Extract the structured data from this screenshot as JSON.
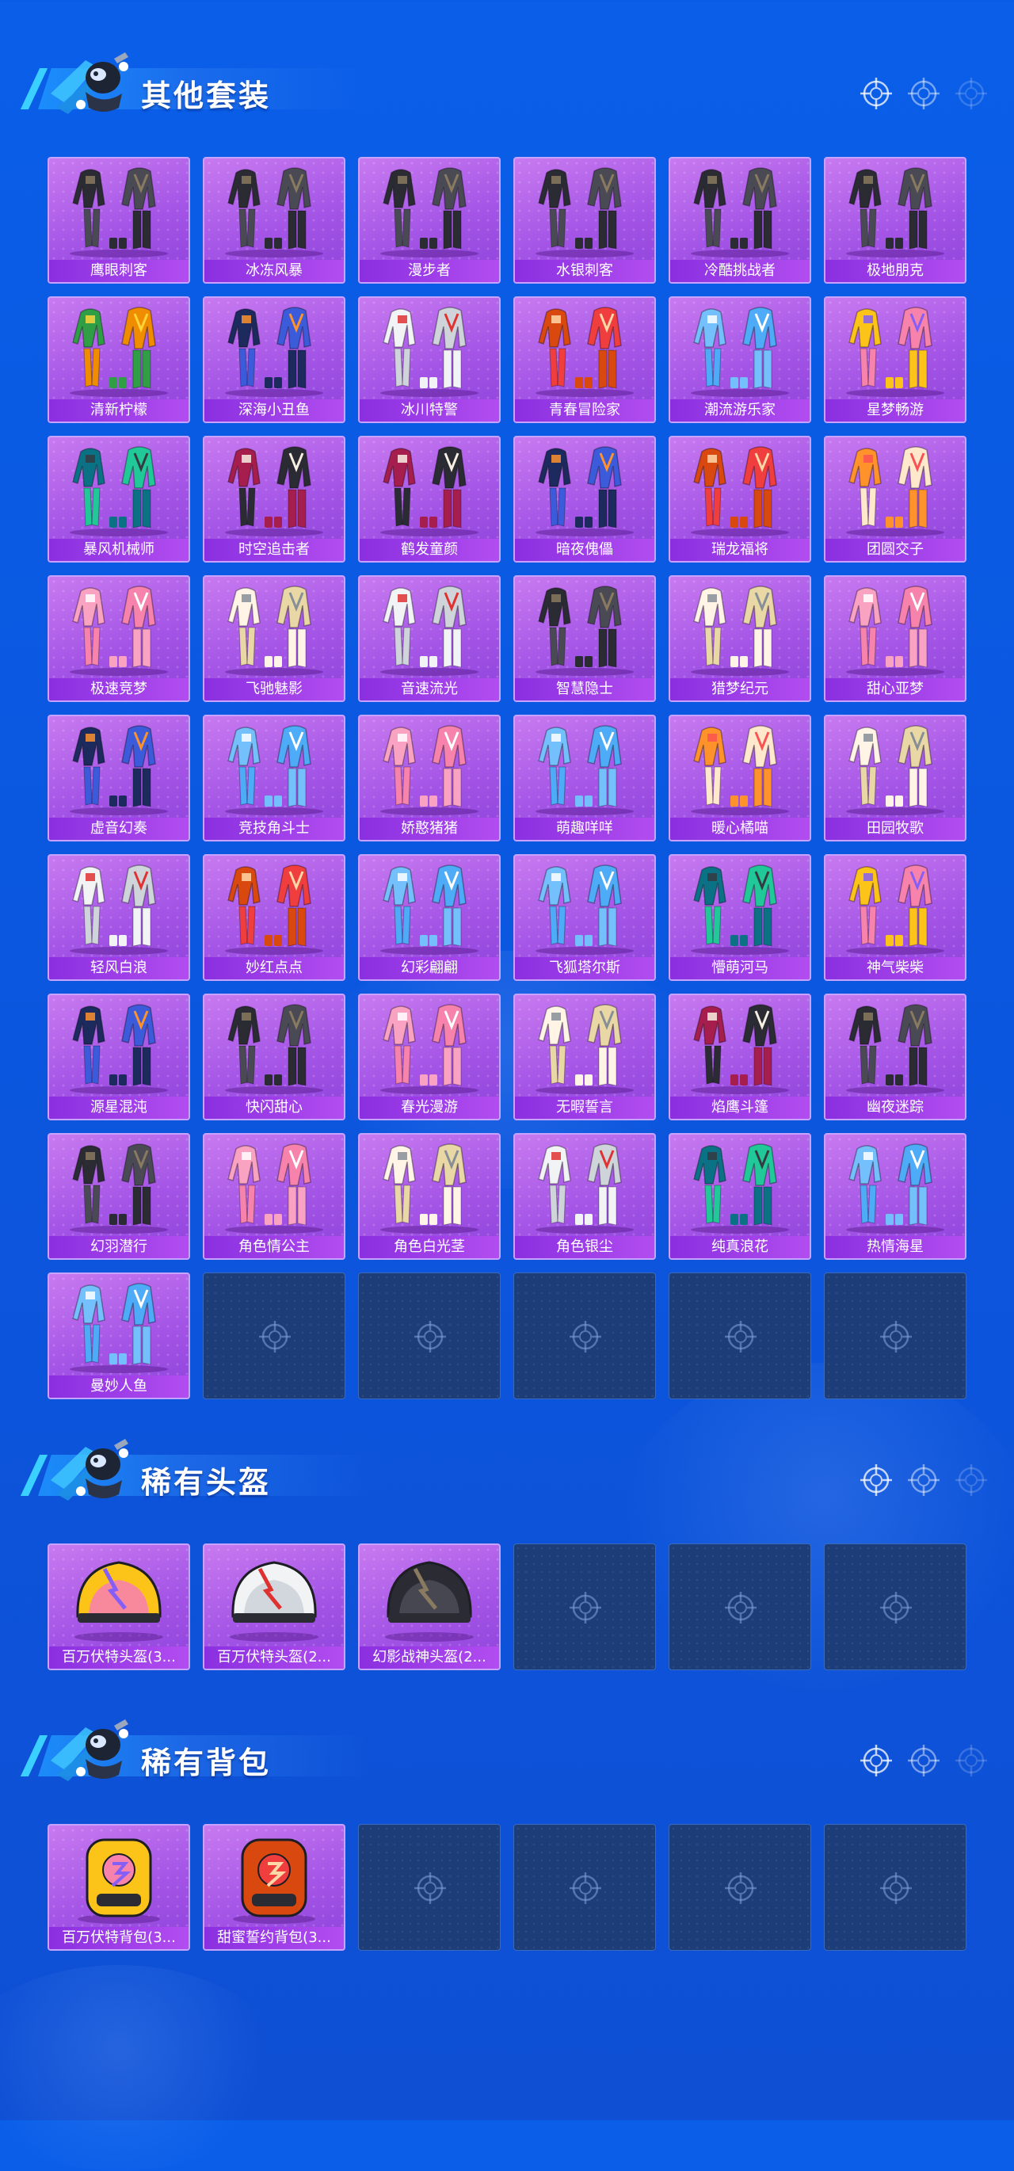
{
  "sections": [
    {
      "title": "其他套装",
      "items": [
        {
          "name": "鹰眼刺客",
          "palette": "dark"
        },
        {
          "name": "冰冻风暴",
          "palette": "dark"
        },
        {
          "name": "漫步者",
          "palette": "dark"
        },
        {
          "name": "水银刺客",
          "palette": "dark"
        },
        {
          "name": "冷酷挑战者",
          "palette": "dark"
        },
        {
          "name": "极地朋克",
          "palette": "dark"
        },
        {
          "name": "清新柠檬",
          "palette": "green"
        },
        {
          "name": "深海小丑鱼",
          "palette": "navy"
        },
        {
          "name": "冰川特警",
          "palette": "white"
        },
        {
          "name": "青春冒险家",
          "palette": "red"
        },
        {
          "name": "潮流游乐家",
          "palette": "blue"
        },
        {
          "name": "星梦畅游",
          "palette": "yellow"
        },
        {
          "name": "暴风机械师",
          "palette": "teal"
        },
        {
          "name": "时空追击者",
          "palette": "crimson"
        },
        {
          "name": "鹤发童颜",
          "palette": "crimson"
        },
        {
          "name": "暗夜傀儡",
          "palette": "navy"
        },
        {
          "name": "瑞龙福将",
          "palette": "red"
        },
        {
          "name": "团圆交子",
          "palette": "orange"
        },
        {
          "name": "极速竞梦",
          "palette": "pink"
        },
        {
          "name": "飞驰魅影",
          "palette": "cream"
        },
        {
          "name": "音速流光",
          "palette": "white"
        },
        {
          "name": "智慧隐士",
          "palette": "dark"
        },
        {
          "name": "猎梦纪元",
          "palette": "cream"
        },
        {
          "name": "甜心亚梦",
          "palette": "pink"
        },
        {
          "name": "虚音幻奏",
          "palette": "navy"
        },
        {
          "name": "竞技角斗士",
          "palette": "blue"
        },
        {
          "name": "娇憨猪猪",
          "palette": "pink"
        },
        {
          "name": "萌趣咩咩",
          "palette": "blue"
        },
        {
          "name": "暖心橘喵",
          "palette": "orange"
        },
        {
          "name": "田园牧歌",
          "palette": "cream"
        },
        {
          "name": "轻风白浪",
          "palette": "white"
        },
        {
          "name": "妙红点点",
          "palette": "red"
        },
        {
          "name": "幻彩翩翩",
          "palette": "blue"
        },
        {
          "name": "飞狐塔尔斯",
          "palette": "blue"
        },
        {
          "name": "懵萌河马",
          "palette": "teal"
        },
        {
          "name": "神气柴柴",
          "palette": "yellow"
        },
        {
          "name": "源星混沌",
          "palette": "navy"
        },
        {
          "name": "快闪甜心",
          "palette": "dark"
        },
        {
          "name": "春光漫游",
          "palette": "pink"
        },
        {
          "name": "无暇誓言",
          "palette": "cream"
        },
        {
          "name": "焰鹰斗篷",
          "palette": "crimson"
        },
        {
          "name": "幽夜迷踪",
          "palette": "dark"
        },
        {
          "name": "幻羽潜行",
          "palette": "dark"
        },
        {
          "name": "角色情公主",
          "palette": "pink"
        },
        {
          "name": "角色白光茎",
          "palette": "cream"
        },
        {
          "name": "角色银尘",
          "palette": "white"
        },
        {
          "name": "纯真浪花",
          "palette": "teal"
        },
        {
          "name": "热情海星",
          "palette": "blue"
        },
        {
          "name": "曼妙人鱼",
          "palette": "blue"
        }
      ],
      "empty_slots": 5
    },
    {
      "title": "稀有头盔",
      "items": [
        {
          "name": "百万伏特头盔(3...",
          "palette": "yellow"
        },
        {
          "name": "百万伏特头盔(2...",
          "palette": "white"
        },
        {
          "name": "幻影战神头盔(2...",
          "palette": "dark"
        }
      ],
      "empty_slots": 3
    },
    {
      "title": "稀有背包",
      "items": [
        {
          "name": "百万伏特背包(3...",
          "palette": "yellow"
        },
        {
          "name": "甜蜜誓约背包(3...",
          "palette": "red"
        }
      ],
      "empty_slots": 4
    }
  ],
  "palettes": {
    "dark": [
      "#2b2b33",
      "#4a4a55",
      "#8a7a60"
    ],
    "green": [
      "#2f9e44",
      "#f08c00",
      "#ffd43b"
    ],
    "navy": [
      "#1c2a5e",
      "#3b5bdb",
      "#ff922b"
    ],
    "white": [
      "#f1f3f5",
      "#ced4da",
      "#e03131"
    ],
    "red": [
      "#d9480f",
      "#f03e3e",
      "#ffd8a8"
    ],
    "blue": [
      "#74c0fc",
      "#4dabf7",
      "#ffffff"
    ],
    "yellow": [
      "#fcc419",
      "#f783ac",
      "#845ef7"
    ],
    "teal": [
      "#0b7285",
      "#20c997",
      "#343a40"
    ],
    "crimson": [
      "#a61e4d",
      "#2b2b33",
      "#f8f0e3"
    ],
    "orange": [
      "#ff922b",
      "#ffe8cc",
      "#fa5252"
    ],
    "pink": [
      "#faa2c1",
      "#f783ac",
      "#ffffff"
    ],
    "cream": [
      "#fff4e6",
      "#e9d8a6",
      "#868e96"
    ]
  },
  "icons": {
    "empty_slot": "crosshair-icon",
    "header_deco": "crosshair-icon",
    "mascot": "skydiver-mascot-icon"
  }
}
